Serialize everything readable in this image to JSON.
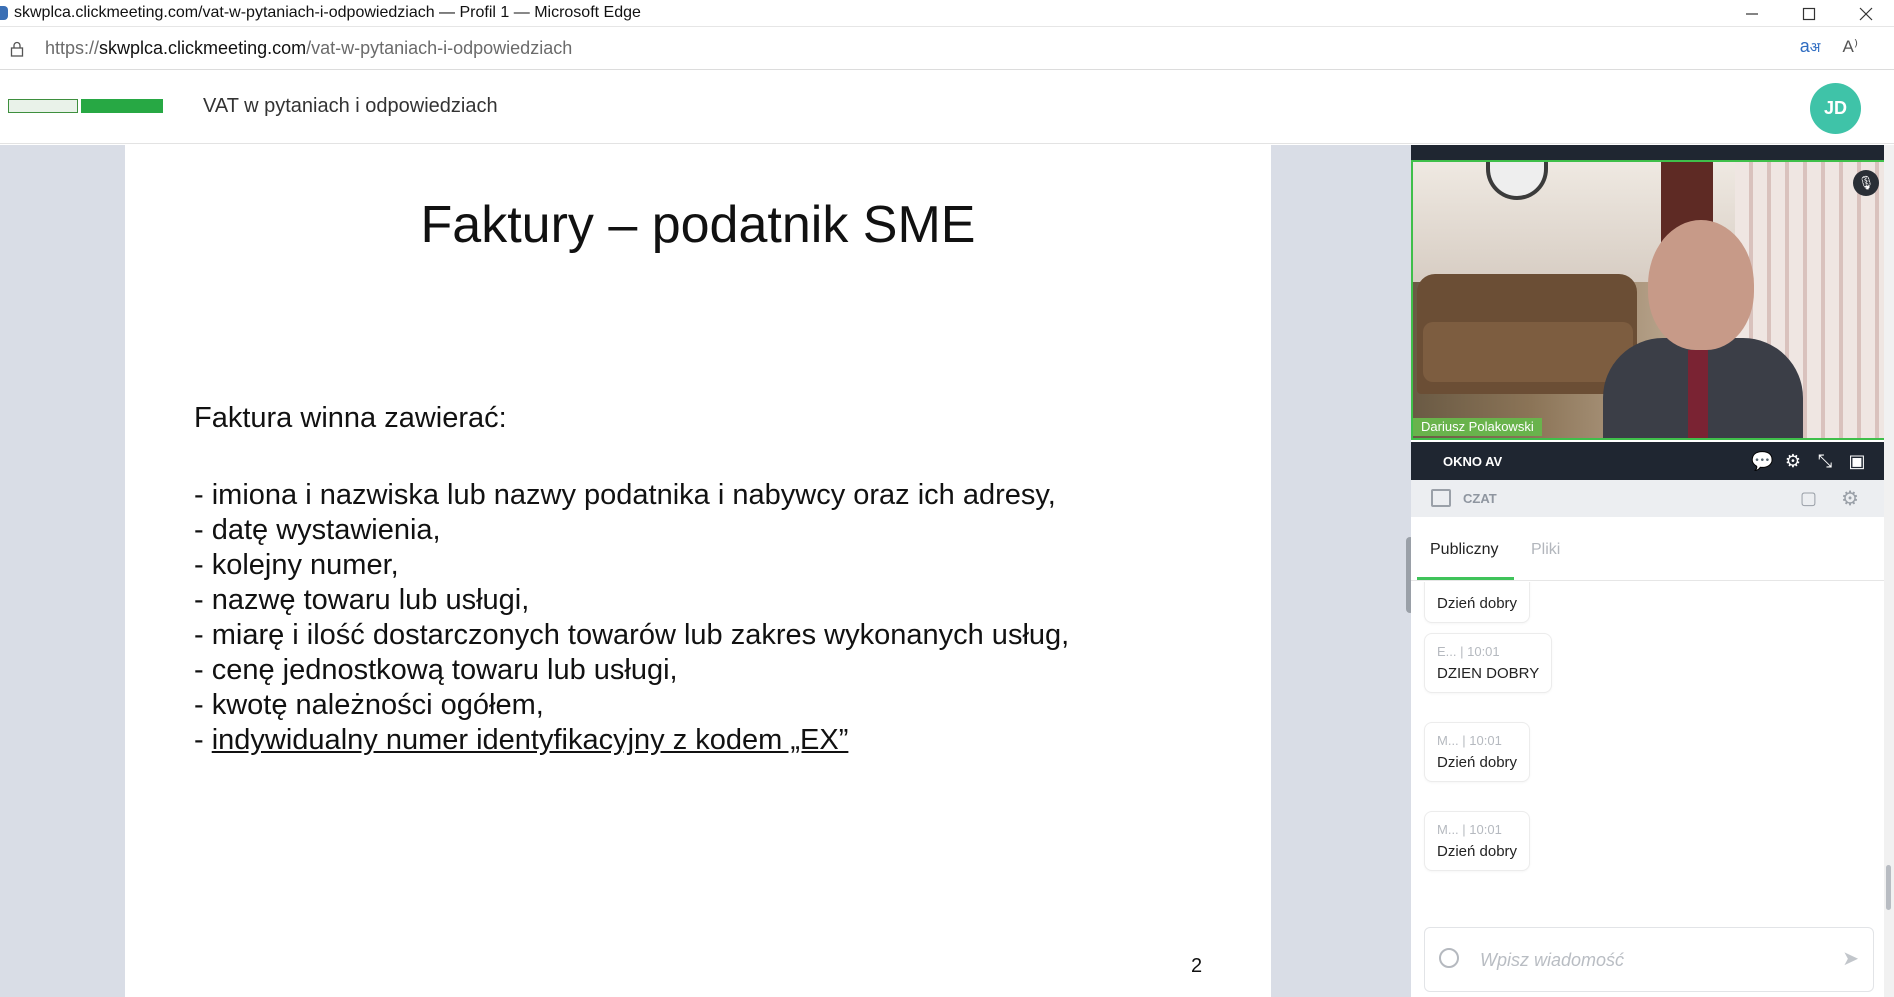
{
  "browser": {
    "window_title": "skwplca.clickmeeting.com/vat-w-pytaniach-i-odpowiedziach — Profil 1 — Microsoft Edge",
    "url_scheme": "https://",
    "url_host": "skwplca.clickmeeting.com",
    "url_path": "/vat-w-pytaniach-i-odpowiedziach",
    "read_aloud_label": "A⁾"
  },
  "header": {
    "event_title": "VAT w pytaniach i odpowiedziach",
    "avatar_initials": "JD",
    "avatar_color": "#3fc3a8"
  },
  "slide": {
    "title": "Faktury – podatnik SME",
    "intro": "Faktura winna zawierać:",
    "items": [
      "- imiona i nazwiska lub nazwy podatnika i nabywcy oraz ich adresy,",
      "- datę wystawienia,",
      "- kolejny numer,",
      "- nazwę towaru lub usługi,",
      "- miarę i ilość dostarczonych towarów lub zakres wykonanych usług,",
      "- cenę jednostkową towaru lub usługi,",
      "- kwotę należności ogółem,"
    ],
    "last_item_prefix": "- ",
    "last_item_underlined": "indywidualny numer identyfikacyjny z kodem „EX”",
    "page_number": "2"
  },
  "av": {
    "presenter_name": "Dariusz Polakowski",
    "panel_label": "OKNO AV"
  },
  "chat": {
    "header_label": "CZAT",
    "tabs": [
      {
        "label": "Publiczny",
        "active": true
      },
      {
        "label": "Pliki",
        "active": false
      }
    ],
    "messages": [
      {
        "meta": "",
        "text": "Dzień dobry"
      },
      {
        "meta": "E...  |  10:01",
        "text": "DZIEN DOBRY"
      },
      {
        "meta": "M...  |  10:01",
        "text": "Dzień dobry"
      },
      {
        "meta": "M...  |  10:01",
        "text": "Dzień dobry"
      }
    ],
    "input_placeholder": "Wpisz wiadomość"
  },
  "colors": {
    "accent_green": "#3fc35a",
    "av_bar": "#1f2631",
    "stage_bg": "#d9dde6"
  },
  "icons": [
    "lock-icon",
    "translate-icon",
    "read-aloud-icon",
    "minimize-icon",
    "maximize-icon",
    "close-icon",
    "microphone-icon",
    "chat-bubble-icon",
    "gear-icon",
    "exit-fullscreen-icon",
    "picture-in-picture-icon",
    "emoji-icon",
    "send-icon"
  ]
}
